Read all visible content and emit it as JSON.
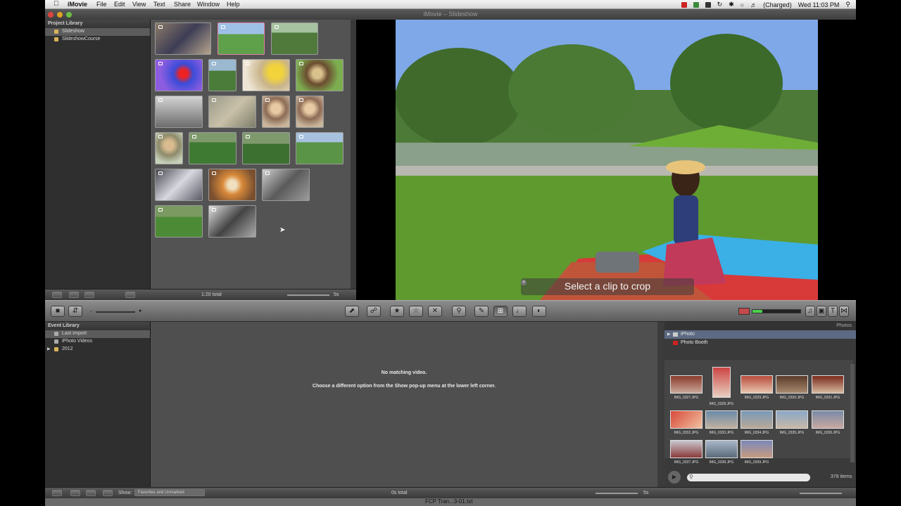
{
  "menubar": {
    "app": "iMovie",
    "items": [
      "File",
      "Edit",
      "View",
      "Text",
      "Share",
      "Window",
      "Help"
    ],
    "battery": "(Charged)",
    "clock": "Wed 11:03 PM"
  },
  "window": {
    "title": "iMovie – Slideshow"
  },
  "project_library": {
    "header": "Project Library",
    "items": [
      {
        "label": "Slideshow",
        "selected": true
      },
      {
        "label": "SlideshowCourse",
        "selected": false
      }
    ],
    "total": "1:20 total",
    "zoom": "5s"
  },
  "viewer": {
    "crop_hint": "Select a clip to crop"
  },
  "event_library": {
    "header": "Event Library",
    "items": [
      {
        "label": "Last Import",
        "selected": true
      },
      {
        "label": "iPhoto Videos",
        "selected": false
      },
      {
        "label": "2012",
        "selected": false
      }
    ],
    "message_title": "No matching video.",
    "message_body": "Choose a different option from the Show pop-up menu at the lower left corner."
  },
  "photos": {
    "header": "Photos",
    "sources": [
      {
        "label": "iPhoto",
        "selected": true
      },
      {
        "label": "Photo Booth",
        "selected": false
      }
    ],
    "captions": [
      "IMG_0327.JPG",
      "IMG_0328.JPG",
      "IMG_0329.JPG",
      "IMG_0330.JPG",
      "IMG_0331.JPG",
      "IMG_0332.JPG",
      "IMG_0333.JPG",
      "IMG_0334.JPG",
      "IMG_0335.JPG",
      "IMG_0336.JPG",
      "IMG_0337.JPG",
      "IMG_0338.JPG",
      "IMG_0339.JPG"
    ],
    "count": "378 items"
  },
  "footer": {
    "show_label": "Show:",
    "show_value": "Favorites and Unmarked",
    "total": "0s total",
    "zoom": "5s"
  },
  "dock": {
    "window_label": "FCP Tran...3-01.txt"
  },
  "colors": {
    "selection": "#5d6a83",
    "panel": "#2f2f2f",
    "browser": "#535353"
  }
}
